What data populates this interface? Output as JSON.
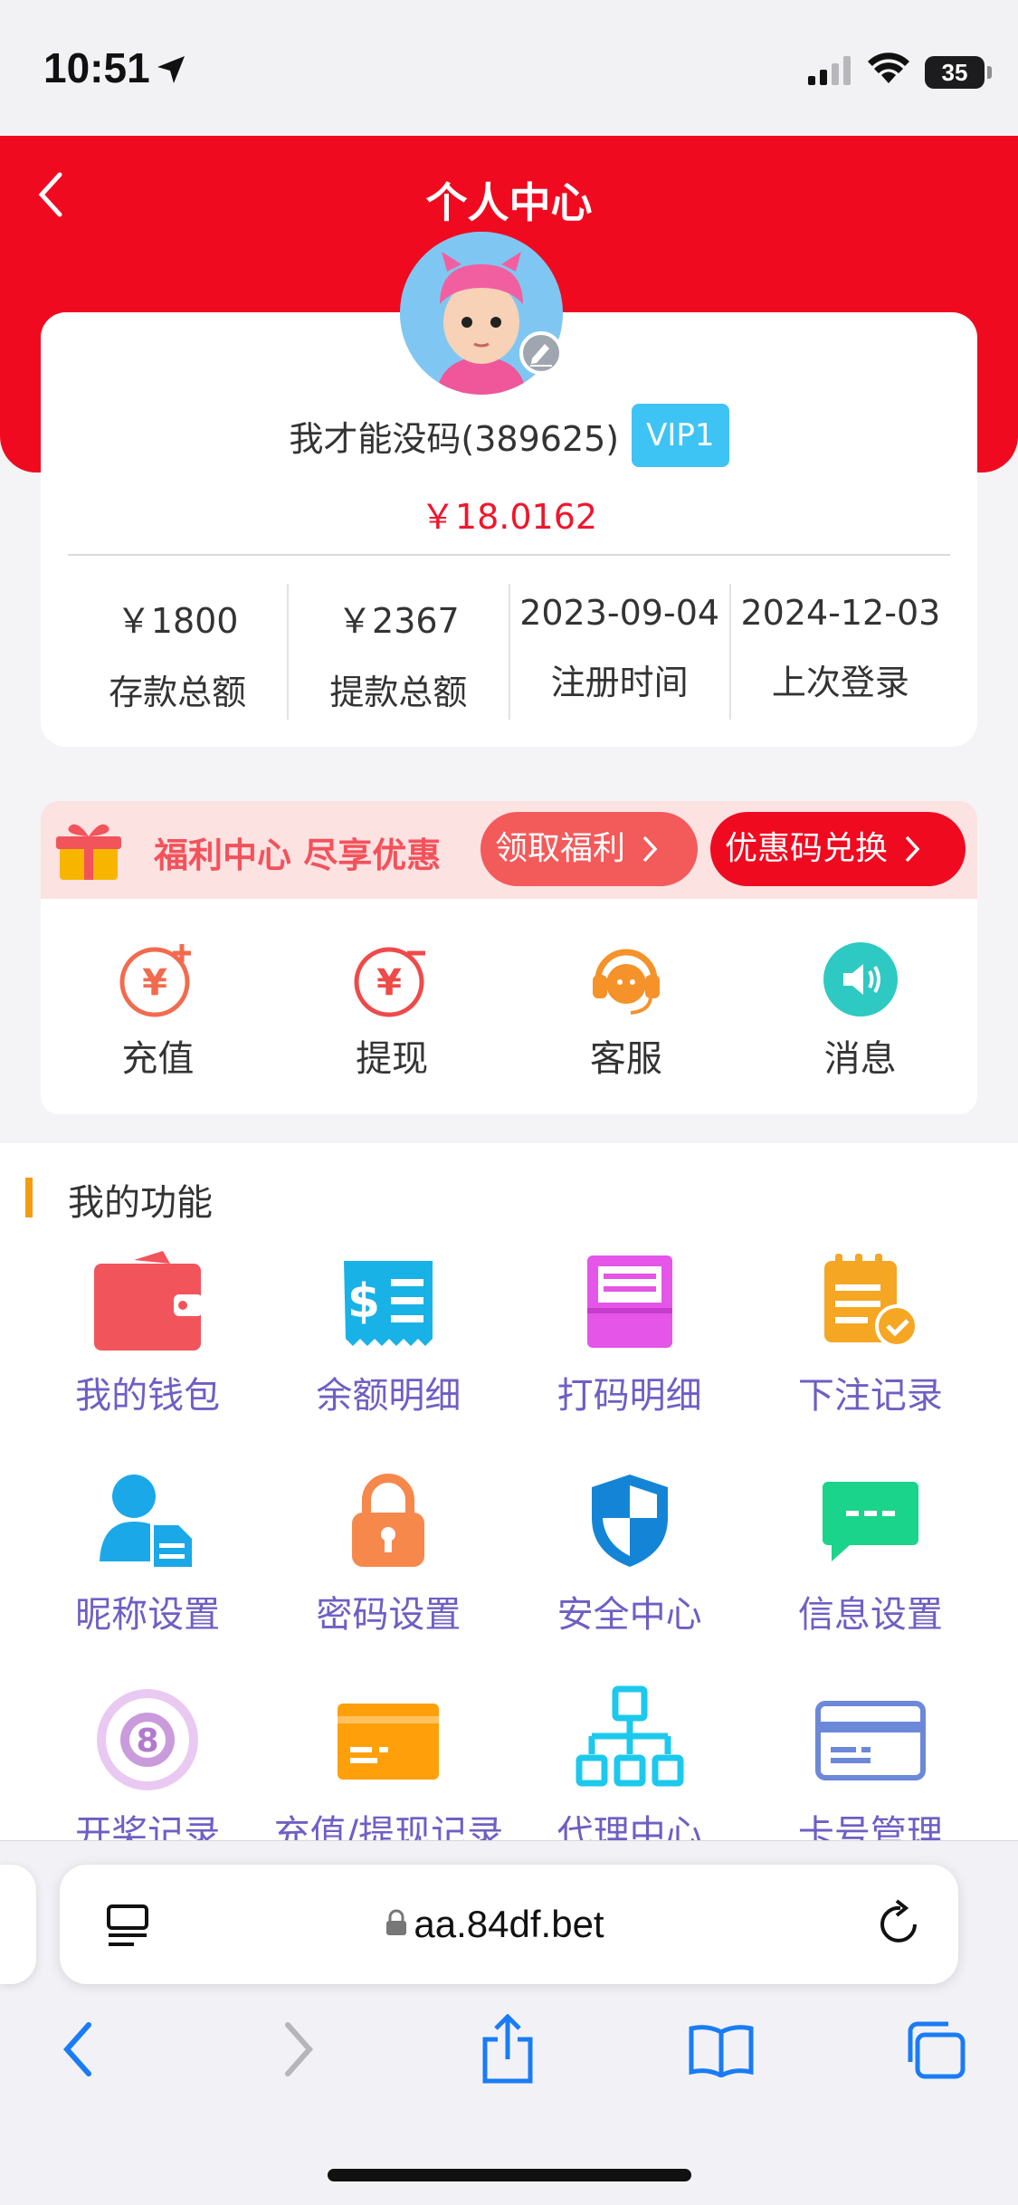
{
  "status": {
    "time": "10:51",
    "battery": "35"
  },
  "header": {
    "title": "个人中心"
  },
  "profile": {
    "username": "我才能没码(389625)",
    "vip": "VIP1",
    "balance": "￥18.0162",
    "stats": [
      {
        "value": "￥1800",
        "label": "存款总额"
      },
      {
        "value": "￥2367",
        "label": "提款总额"
      },
      {
        "value": "2023-09-04",
        "label": "注册时间"
      },
      {
        "value": "2024-12-03",
        "label": "上次登录"
      }
    ]
  },
  "welfare": {
    "text": "福利中心 尽享优惠",
    "claim": "领取福利",
    "code": "优惠码兑换"
  },
  "quick": [
    {
      "label": "充值",
      "icon": "recharge-icon"
    },
    {
      "label": "提现",
      "icon": "withdraw-icon"
    },
    {
      "label": "客服",
      "icon": "support-icon"
    },
    {
      "label": "消息",
      "icon": "message-icon"
    }
  ],
  "functions": {
    "title": "我的功能",
    "items": [
      {
        "label": "我的钱包",
        "icon": "wallet-icon"
      },
      {
        "label": "余额明细",
        "icon": "balance-detail-icon"
      },
      {
        "label": "打码明细",
        "icon": "bet-detail-icon"
      },
      {
        "label": "下注记录",
        "icon": "bet-record-icon"
      },
      {
        "label": "昵称设置",
        "icon": "nickname-icon"
      },
      {
        "label": "密码设置",
        "icon": "lock-icon"
      },
      {
        "label": "安全中心",
        "icon": "shield-icon"
      },
      {
        "label": "信息设置",
        "icon": "chat-icon"
      },
      {
        "label": "开奖记录",
        "icon": "lottery-ball-icon"
      },
      {
        "label": "充值/提现记录",
        "icon": "card-record-icon"
      },
      {
        "label": "代理中心",
        "icon": "org-chart-icon"
      },
      {
        "label": "卡号管理",
        "icon": "bank-card-icon"
      }
    ]
  },
  "browser": {
    "url": "aa.84df.bet"
  },
  "colors": {
    "brand_red": "#f00a20",
    "vip_blue": "#3ec3f5",
    "label_purple": "#6e5fc4"
  }
}
